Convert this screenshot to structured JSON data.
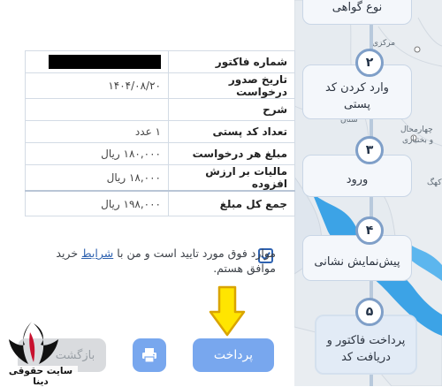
{
  "steps": [
    {
      "num": "",
      "label": "نوع گواهی"
    },
    {
      "num": "۲",
      "label": "وارد کردن کد پستی"
    },
    {
      "num": "۳",
      "label": "ورود"
    },
    {
      "num": "۴",
      "label": "پیش‌نمایش نشانی"
    },
    {
      "num": "۵",
      "label": "پرداخت فاکتور و دریافت کد"
    }
  ],
  "map_labels": {
    "markazi": "مرکزی",
    "charmahal": "چهارمحال",
    "bakhtiari": "و بختیاری",
    "ostan": "ستان",
    "kohgiluyeh": "کهگ"
  },
  "invoice": {
    "rows": [
      {
        "key": "شماره فاکتور",
        "value": ""
      },
      {
        "key": "تاریخ صدور درخواست",
        "value": "۱۴۰۴/۰۸/۲۰"
      },
      {
        "key": "شرح",
        "value": ""
      },
      {
        "key": "تعداد کد پستی",
        "value": "۱ عدد"
      },
      {
        "key": "مبلغ هر درخواست",
        "value": "۱۸۰,۰۰۰ ریال"
      },
      {
        "key": "مالیات بر ارزش افزوده",
        "value": "۱۸,۰۰۰ ریال"
      }
    ],
    "total": {
      "key": "جمع کل مبلغ",
      "value": "۱۹۸,۰۰۰ ریال"
    }
  },
  "terms": {
    "before": "موارد فوق مورد تایید است و من با ",
    "link": "شرایط",
    "after": " خرید موافق هستم.",
    "checked": true
  },
  "buttons": {
    "pay": "پرداخت",
    "back": "بازگشت"
  },
  "logo": {
    "text": "سایت حقوقی دینا"
  },
  "colors": {
    "accent": "#78a7ee",
    "link": "#2e62b0",
    "arrow": "#ffe500"
  }
}
